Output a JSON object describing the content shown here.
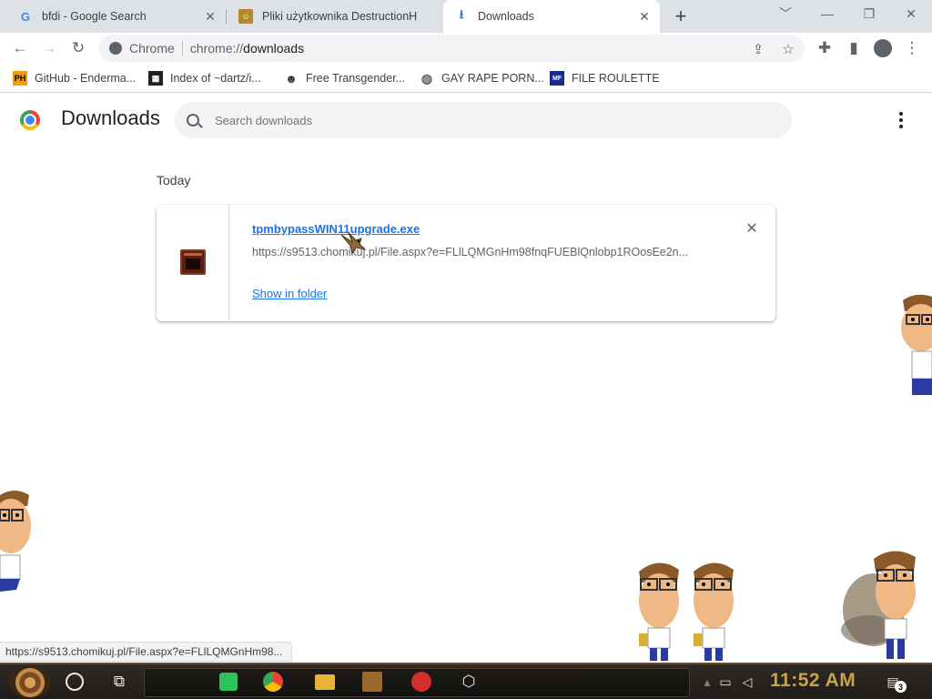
{
  "tabs": [
    {
      "title": "bfdi - Google Search",
      "icon": "google-g-icon",
      "active": false
    },
    {
      "title": "Pliki użytkownika DestructionH",
      "icon": "user-avatar-icon",
      "active": false
    },
    {
      "title": "Downloads",
      "icon": "download-arrow-icon",
      "active": true
    }
  ],
  "window_controls": {
    "tab_search": "﹀",
    "minimize": "—",
    "restore": "❐",
    "close": "✕"
  },
  "toolbar": {
    "back": "←",
    "forward": "→",
    "reload": "↻",
    "omnibox_label": "Chrome",
    "url_scheme": "chrome://",
    "url_path": "downloads",
    "share": "⇪",
    "star": "☆",
    "extensions": "✚",
    "sidepanel": "▮",
    "profile": "●",
    "menu": "⋮"
  },
  "bookmarks": [
    {
      "label": "GitHub - Enderma...",
      "icon": "ph-icon"
    },
    {
      "label": "Index of ~dartz/i...",
      "icon": "pixel-art-icon"
    },
    {
      "label": "Free Transgender...",
      "icon": "cat-face-icon"
    },
    {
      "label": "GAY RAPE PORN...",
      "icon": "globe-icon"
    },
    {
      "label": "FILE ROULETTE",
      "icon": "mf-icon"
    }
  ],
  "downloads_page": {
    "title": "Downloads",
    "search_placeholder": "Search downloads",
    "section": "Today",
    "items": [
      {
        "file_name": "tpmbypassWIN11upgrade.exe",
        "url": "https://s9513.chomikuj.pl/File.aspx?e=FLlLQMGnHm98fnqFUEBlQnlobp1ROosEe2n...",
        "action": "Show in folder"
      }
    ]
  },
  "status_url": "https://s9513.chomikuj.pl/File.aspx?e=FLlLQMGnHm98...",
  "taskbar": {
    "clock": "11:52 AM",
    "notification_count": "3"
  },
  "colors": {
    "accent": "#1a73e8",
    "tabstrip": "#dee1e6",
    "clock": "#c9a34a"
  }
}
